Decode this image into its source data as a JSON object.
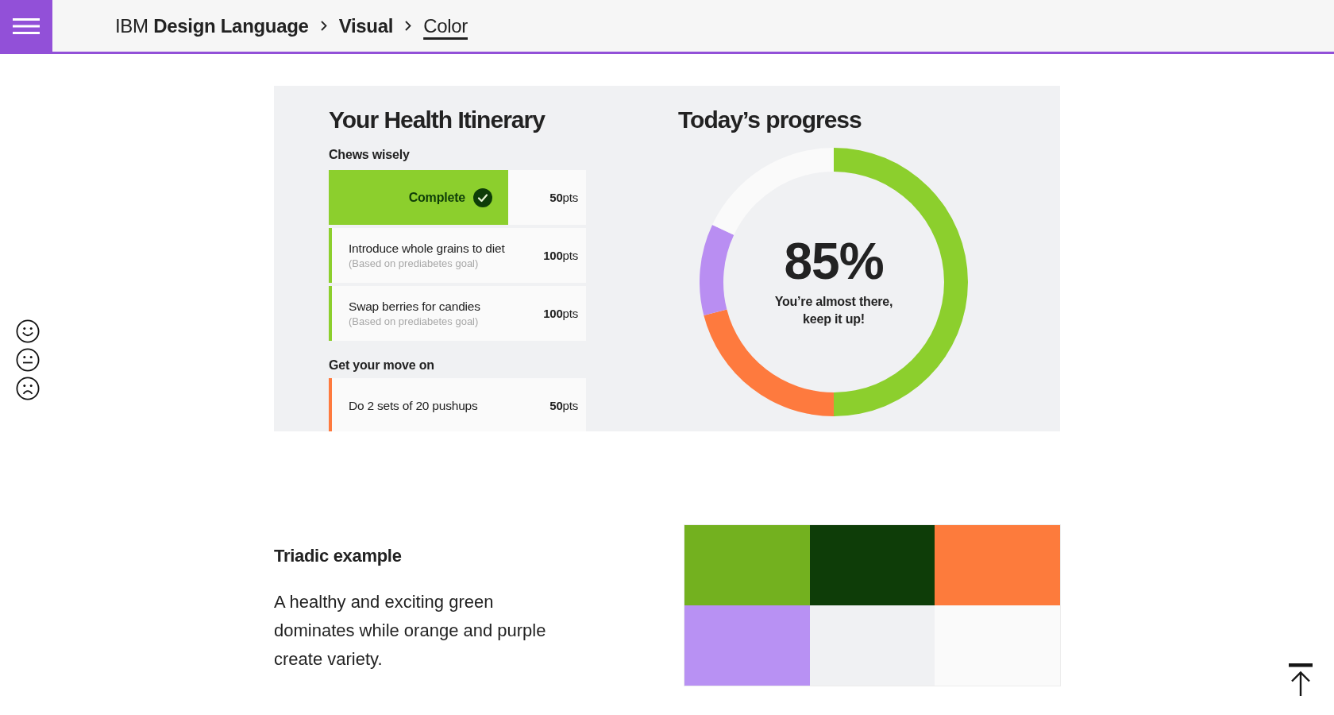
{
  "header": {
    "site_title": "IBM **Design Language**",
    "breadcrumb": [
      {
        "label": "Visual",
        "selected": false
      },
      {
        "label": "Color",
        "selected": true
      }
    ]
  },
  "itinerary": {
    "title": "Your Health Itinerary",
    "groups": [
      {
        "title": "Chews wisely",
        "color": "#8ccf2d",
        "tasks": [
          {
            "complete": true,
            "status": "Complete",
            "points": "**50**pts"
          },
          {
            "complete": false,
            "title": "Introduce whole grains to diet",
            "note": "(Based on prediabetes goal)",
            "points": "**100**pts"
          },
          {
            "complete": false,
            "title": "Swap berries for candies",
            "note": "(Based on prediabetes goal)",
            "points": "**100**pts"
          }
        ]
      },
      {
        "title": "Get your move on",
        "color": "#fe7a3e",
        "tasks": [
          {
            "complete": false,
            "title": "Do 2 sets of 20 pushups",
            "points": "**50**pts"
          }
        ]
      }
    ]
  },
  "progress": {
    "title": "Today’s progress",
    "value": "85%",
    "message": "You’re almost there, keep it up!",
    "chart_data": {
      "type": "donut",
      "values": [
        50,
        21,
        11,
        18
      ],
      "colors": [
        "#8ccf2d",
        "#fe7a3e",
        "#b98ef2",
        "#fafafa"
      ]
    }
  },
  "triadic": {
    "title": "Triadic example",
    "text": "A healthy and exciting green dominates while orange and purple create variety.",
    "swatches": [
      {
        "color": "#73b11f"
      },
      {
        "color": "#0e3d08"
      },
      {
        "color": "#fd7b3c"
      },
      {
        "color": "#b891f3"
      },
      {
        "color": "#f0f1f3"
      },
      {
        "color": "#fafafa"
      }
    ]
  }
}
